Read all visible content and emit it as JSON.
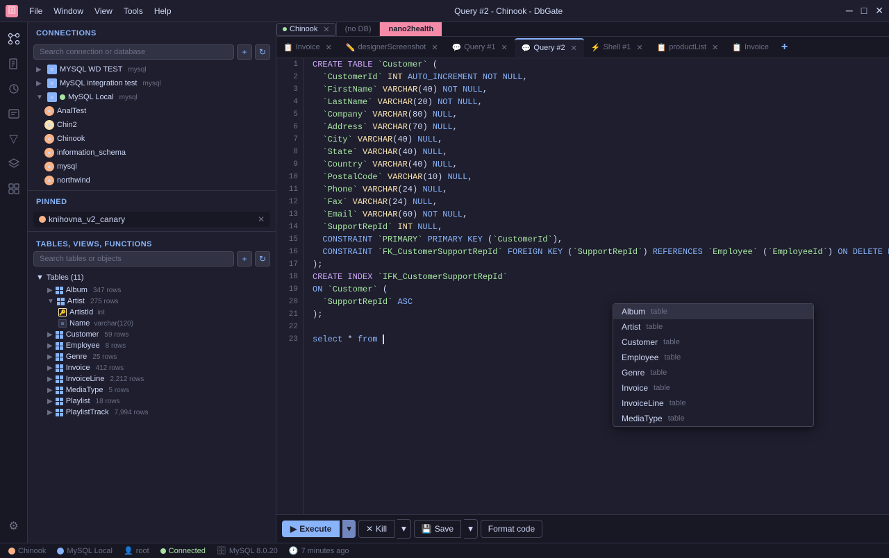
{
  "titlebar": {
    "app_icon": "🗄",
    "menu": [
      "File",
      "Window",
      "View",
      "Tools",
      "Help"
    ],
    "title": "Query #2 - Chinook - DbGate",
    "controls": [
      "─",
      "□",
      "✕"
    ]
  },
  "connections": {
    "section_label": "CONNECTIONS",
    "search_placeholder": "Search connection or database",
    "items": [
      {
        "id": "mysql-test",
        "label": "MYSQL WD TEST",
        "type": "mysql",
        "expanded": false,
        "color": "#89b4fa"
      },
      {
        "id": "mysql-integration",
        "label": "MySQL integration test",
        "type": "mysql",
        "expanded": false,
        "color": "#89b4fa"
      },
      {
        "id": "mysql-local",
        "label": "MySQL Local",
        "type": "mysql",
        "expanded": true,
        "active": true,
        "color": "#89b4fa"
      },
      {
        "id": "analtest",
        "label": "AnalTest",
        "expanded": false,
        "color": "#fab387"
      },
      {
        "id": "chin2",
        "label": "Chin2",
        "expanded": false,
        "color": "#fab387"
      },
      {
        "id": "chinook",
        "label": "Chinook",
        "expanded": false,
        "color": "#fab387",
        "active": true
      },
      {
        "id": "information_schema",
        "label": "information_schema",
        "expanded": false,
        "color": "#fab387"
      },
      {
        "id": "mysql",
        "label": "mysql",
        "expanded": false,
        "color": "#fab387"
      },
      {
        "id": "northwind",
        "label": "northwind",
        "expanded": false,
        "color": "#fab387"
      }
    ]
  },
  "pinned": {
    "section_label": "PINNED",
    "item": {
      "label": "knihovna_v2_canary",
      "color": "#fab387"
    }
  },
  "tables": {
    "section_label": "TABLES, VIEWS, FUNCTIONS",
    "search_placeholder": "Search tables or objects",
    "group_label": "Tables (11)",
    "items": [
      {
        "name": "Album",
        "rows": "347 rows",
        "expanded": false
      },
      {
        "name": "Artist",
        "rows": "275 rows",
        "expanded": true,
        "fields": [
          {
            "name": "ArtistId",
            "type": "int",
            "key": true
          },
          {
            "name": "Name",
            "type": "varchar(120)",
            "key": false
          }
        ]
      },
      {
        "name": "Customer",
        "rows": "59 rows",
        "expanded": false
      },
      {
        "name": "Employee",
        "rows": "8 rows",
        "expanded": false
      },
      {
        "name": "Genre",
        "rows": "25 rows",
        "expanded": false
      },
      {
        "name": "Invoice",
        "rows": "412 rows",
        "expanded": false
      },
      {
        "name": "InvoiceLine",
        "rows": "2,212 rows",
        "expanded": false
      },
      {
        "name": "MediaType",
        "rows": "5 rows",
        "expanded": false
      },
      {
        "name": "Playlist",
        "rows": "18 rows",
        "expanded": false
      },
      {
        "name": "PlaylistTrack",
        "rows": "7,994 rows",
        "expanded": false
      }
    ]
  },
  "tabs": {
    "connection_name": "Chinook",
    "nodb_label": "(no DB)",
    "nano2health_label": "nano2health",
    "items": [
      {
        "id": "invoice",
        "label": "Invoice",
        "icon": "📋",
        "active": false
      },
      {
        "id": "designer",
        "label": "designerScreenshot",
        "icon": "✏️",
        "active": false
      },
      {
        "id": "query1",
        "label": "Query #1",
        "icon": "💬",
        "active": false
      },
      {
        "id": "query2",
        "label": "Query #2",
        "icon": "💬",
        "active": true
      },
      {
        "id": "shell1",
        "label": "Shell #1",
        "icon": "⚡",
        "active": false
      },
      {
        "id": "productlist",
        "label": "productList",
        "icon": "📋",
        "active": false
      },
      {
        "id": "invoice2",
        "label": "Invoice",
        "icon": "📋",
        "active": false
      }
    ]
  },
  "editor": {
    "lines": [
      {
        "num": 1,
        "code": "CREATE TABLE `Customer` ("
      },
      {
        "num": 2,
        "code": "  `CustomerId` INT AUTO_INCREMENT NOT NULL,"
      },
      {
        "num": 3,
        "code": "  `FirstName` VARCHAR(40) NOT NULL,"
      },
      {
        "num": 4,
        "code": "  `LastName` VARCHAR(20) NOT NULL,"
      },
      {
        "num": 5,
        "code": "  `Company` VARCHAR(80) NULL,"
      },
      {
        "num": 6,
        "code": "  `Address` VARCHAR(70) NULL,"
      },
      {
        "num": 7,
        "code": "  `City` VARCHAR(40) NULL,"
      },
      {
        "num": 8,
        "code": "  `State` VARCHAR(40) NULL,"
      },
      {
        "num": 9,
        "code": "  `Country` VARCHAR(40) NULL,"
      },
      {
        "num": 10,
        "code": "  `PostalCode` VARCHAR(10) NULL,"
      },
      {
        "num": 11,
        "code": "  `Phone` VARCHAR(24) NULL,"
      },
      {
        "num": 12,
        "code": "  `Fax` VARCHAR(24) NULL,"
      },
      {
        "num": 13,
        "code": "  `Email` VARCHAR(60) NOT NULL,"
      },
      {
        "num": 14,
        "code": "  `SupportRepId` INT NULL,"
      },
      {
        "num": 15,
        "code": "  CONSTRAINT `PRIMARY` PRIMARY KEY (`CustomerId`),"
      },
      {
        "num": 16,
        "code": "  CONSTRAINT `FK_CustomerSupportRepId` FOREIGN KEY (`SupportRepId`) REFERENCES `Employee` (`EmployeeId`) ON DELETE NO ACTION ON UPDATE NO ACTION"
      },
      {
        "num": 17,
        "code": ");"
      },
      {
        "num": 18,
        "code": "CREATE INDEX `IFK_CustomerSupportRepId`"
      },
      {
        "num": 19,
        "code": "ON `Customer` ("
      },
      {
        "num": 20,
        "code": "  `SupportRepId` ASC"
      },
      {
        "num": 21,
        "code": ");"
      },
      {
        "num": 22,
        "code": ""
      },
      {
        "num": 23,
        "code": "select * from |"
      }
    ]
  },
  "autocomplete": {
    "items": [
      {
        "name": "Album",
        "type": "table",
        "selected": true
      },
      {
        "name": "Artist",
        "type": "table",
        "selected": false
      },
      {
        "name": "Customer",
        "type": "table",
        "selected": false
      },
      {
        "name": "Employee",
        "type": "table",
        "selected": false
      },
      {
        "name": "Genre",
        "type": "table",
        "selected": false
      },
      {
        "name": "Invoice",
        "type": "table",
        "selected": false
      },
      {
        "name": "InvoiceLine",
        "type": "table",
        "selected": false
      },
      {
        "name": "MediaType",
        "type": "table",
        "selected": false
      }
    ]
  },
  "toolbar": {
    "execute_label": "Execute",
    "kill_label": "Kill",
    "save_label": "Save",
    "format_label": "Format code"
  },
  "statusbar": {
    "chinook_label": "Chinook",
    "mysql_local_label": "MySQL Local",
    "user_label": "root",
    "connected_label": "Connected",
    "version_label": "MySQL 8.0.20",
    "time_label": "7 minutes ago"
  }
}
